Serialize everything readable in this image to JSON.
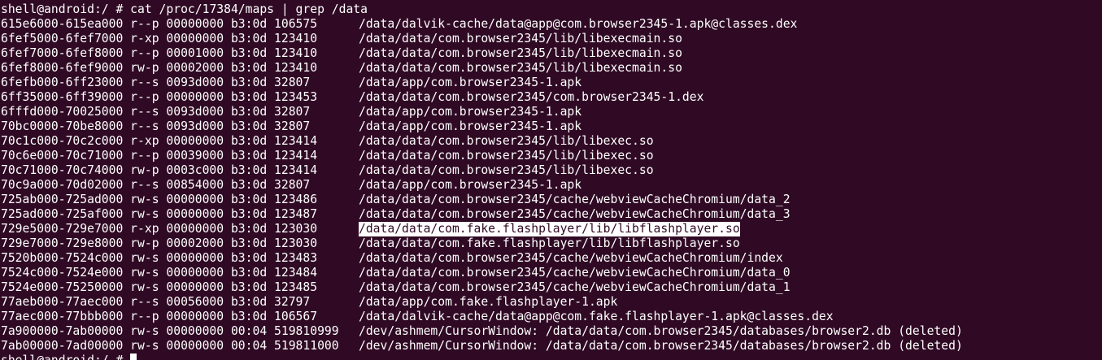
{
  "command_line": {
    "prompt": "shell@android:/ # ",
    "command": "cat /proc/17384/maps | grep /data"
  },
  "lines": [
    {
      "meta": "615e6000-615ea000 r--p 00000000 b3:0d 106575",
      "path": "/data/dalvik-cache/data@app@com.browser2345-1.apk@classes.dex"
    },
    {
      "meta": "6fef5000-6fef7000 r-xp 00000000 b3:0d 123410",
      "path": "/data/data/com.browser2345/lib/libexecmain.so"
    },
    {
      "meta": "6fef7000-6fef8000 r--p 00001000 b3:0d 123410",
      "path": "/data/data/com.browser2345/lib/libexecmain.so"
    },
    {
      "meta": "6fef8000-6fef9000 rw-p 00002000 b3:0d 123410",
      "path": "/data/data/com.browser2345/lib/libexecmain.so"
    },
    {
      "meta": "6fefb000-6ff23000 r--s 0093d000 b3:0d 32807",
      "path": "/data/app/com.browser2345-1.apk"
    },
    {
      "meta": "6ff35000-6ff39000 r--p 00000000 b3:0d 123453",
      "path": "/data/data/com.browser2345/com.browser2345-1.dex"
    },
    {
      "meta": "6fffd000-70025000 r--s 0093d000 b3:0d 32807",
      "path": "/data/app/com.browser2345-1.apk"
    },
    {
      "meta": "70bc0000-70be8000 r--s 0093d000 b3:0d 32807",
      "path": "/data/app/com.browser2345-1.apk"
    },
    {
      "meta": "70c1c000-70c2c000 r-xp 00000000 b3:0d 123414",
      "path": "/data/data/com.browser2345/lib/libexec.so"
    },
    {
      "meta": "70c6e000-70c71000 r--p 00039000 b3:0d 123414",
      "path": "/data/data/com.browser2345/lib/libexec.so"
    },
    {
      "meta": "70c71000-70c74000 rw-p 0003c000 b3:0d 123414",
      "path": "/data/data/com.browser2345/lib/libexec.so"
    },
    {
      "meta": "70c9a000-70d02000 r--s 00854000 b3:0d 32807",
      "path": "/data/app/com.browser2345-1.apk"
    },
    {
      "meta": "725ab000-725ad000 rw-s 00000000 b3:0d 123486",
      "path": "/data/data/com.browser2345/cache/webviewCacheChromium/data_2"
    },
    {
      "meta": "725ad000-725af000 rw-s 00000000 b3:0d 123487",
      "path": "/data/data/com.browser2345/cache/webviewCacheChromium/data_3"
    },
    {
      "meta": "729e5000-729e7000 r-xp 00000000 b3:0d 123030",
      "path": "/data/data/com.fake.flashplayer/lib/libflashplayer.so",
      "highlighted": true
    },
    {
      "meta": "729e7000-729e8000 rw-p 00002000 b3:0d 123030",
      "path": "/data/data/com.fake.flashplayer/lib/libflashplayer.so"
    },
    {
      "meta": "7520b000-7524c000 rw-s 00000000 b3:0d 123483",
      "path": "/data/data/com.browser2345/cache/webviewCacheChromium/index"
    },
    {
      "meta": "7524c000-7524e000 rw-s 00000000 b3:0d 123484",
      "path": "/data/data/com.browser2345/cache/webviewCacheChromium/data_0"
    },
    {
      "meta": "7524e000-75250000 rw-s 00000000 b3:0d 123485",
      "path": "/data/data/com.browser2345/cache/webviewCacheChromium/data_1"
    },
    {
      "meta": "77aeb000-77aec000 r--s 00056000 b3:0d 32797",
      "path": "/data/app/com.fake.flashplayer-1.apk"
    },
    {
      "meta": "77aec000-77bbb000 r--p 00000000 b3:0d 106567",
      "path": "/data/dalvik-cache/data@app@com.fake.flashplayer-1.apk@classes.dex"
    },
    {
      "meta": "7a900000-7ab00000 rw-s 00000000 00:04 519810999",
      "path": "/dev/ashmem/CursorWindow: /data/data/com.browser2345/databases/browser2.db (deleted)"
    },
    {
      "meta": "7ab00000-7ad00000 rw-s 00000000 00:04 519811000",
      "path": "/dev/ashmem/CursorWindow: /data/data/com.browser2345/databases/browser2.db (deleted)"
    }
  ],
  "final_prompt": "shell@android:/ # ",
  "colors": {
    "background": "#300a24",
    "foreground": "#ffffff",
    "selection_bg": "#ffffff",
    "selection_fg": "#300a24"
  }
}
